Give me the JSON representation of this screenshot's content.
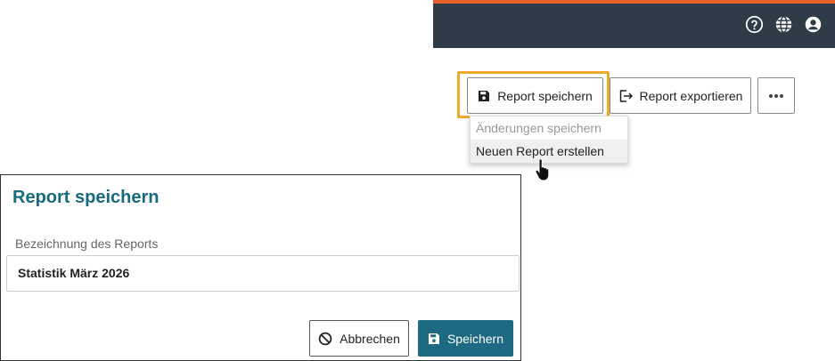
{
  "topbar": {
    "icons": [
      "help-circle-icon",
      "globe-icon",
      "account-circle-icon"
    ],
    "accent_color": "#e8612c",
    "background_color": "#2f3b47"
  },
  "toolbar": {
    "save_label": "Report speichern",
    "export_label": "Report exportieren",
    "more_icon": "more-horizontal-icon"
  },
  "dropdown": {
    "items": [
      {
        "label": "Änderungen speichern",
        "state": "disabled"
      },
      {
        "label": "Neuen Report erstellen",
        "state": "hover"
      }
    ]
  },
  "dialog": {
    "title": "Report speichern",
    "field_label": "Bezeichnung des Reports",
    "field_value": "Statistik März 2026",
    "cancel_label": "Abbrechen",
    "submit_label": "Speichern",
    "accent_color": "#1d6a82"
  },
  "highlight_color": "#f0a92c"
}
